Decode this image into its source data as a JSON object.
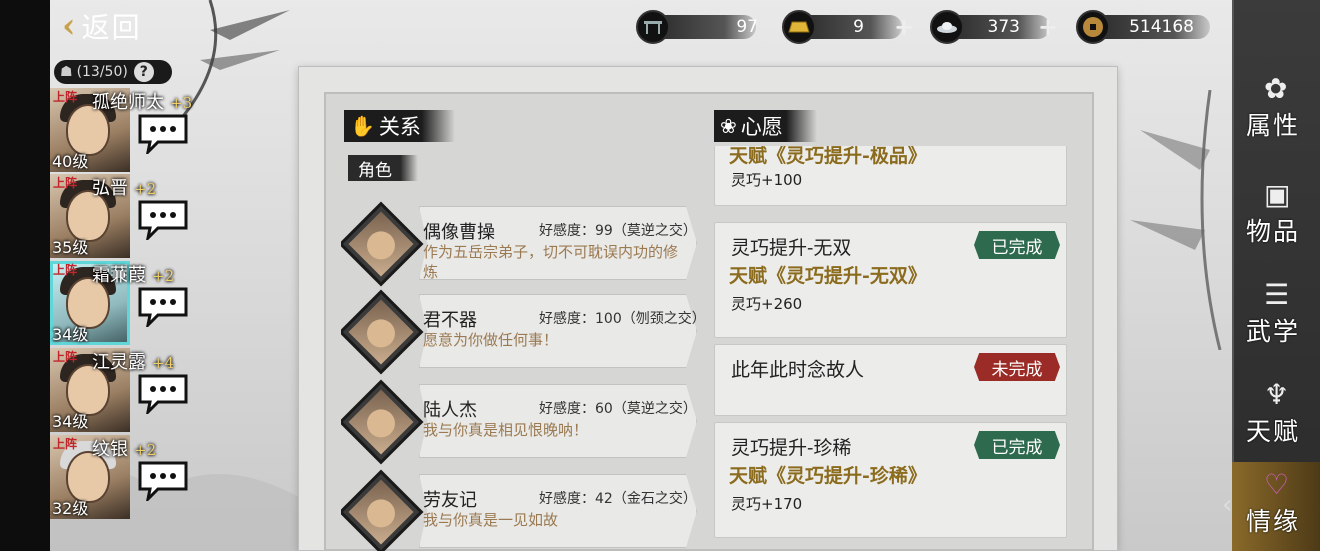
{
  "back": {
    "label": "返回"
  },
  "resources": [
    {
      "icon": "table-icon",
      "value": "97",
      "has_plus": false
    },
    {
      "icon": "gold-bar-icon",
      "value": "9",
      "has_plus": true
    },
    {
      "icon": "silver-ingot-icon",
      "value": "373",
      "has_plus": true
    },
    {
      "icon": "copper-coin-icon",
      "value": "514168",
      "has_plus": false
    }
  ],
  "roster": {
    "count": "(13/50)",
    "heroes": [
      {
        "onstage": "上阵",
        "name": "孤绝师太",
        "plus": "+3",
        "level": "40级",
        "selected": false
      },
      {
        "onstage": "上阵",
        "name": "弘晋",
        "plus": "+2",
        "level": "35级",
        "selected": false
      },
      {
        "onstage": "上阵",
        "name": "霜蒹葭",
        "plus": "+2",
        "level": "34级",
        "selected": true
      },
      {
        "onstage": "上阵",
        "name": "江灵露",
        "plus": "+4",
        "level": "34级",
        "selected": false
      },
      {
        "onstage": "上阵",
        "name": "纹银",
        "plus": "+2",
        "level": "32级",
        "selected": false
      }
    ]
  },
  "relations": {
    "tab_label": "关系",
    "role_tab": "角色",
    "items": [
      {
        "name": "偶像曹操",
        "fav": "好感度：99（莫逆之交）",
        "msg": "作为五岳宗弟子，切不可耽误内功的修炼"
      },
      {
        "name": "君不器",
        "fav": "好感度：100（刎颈之交）",
        "msg": "愿意为你做任何事！"
      },
      {
        "name": "陆人杰",
        "fav": "好感度：60（莫逆之交）",
        "msg": "我与你真是相见恨晚呐！"
      },
      {
        "name": "劳友记",
        "fav": "好感度：42（金石之交）",
        "msg": "我与你真是一见如故"
      }
    ]
  },
  "wishes": {
    "tab_label": "心愿",
    "items": [
      {
        "title": "",
        "reward": "天赋《灵巧提升-极品》",
        "attr": "灵巧+100",
        "status": ""
      },
      {
        "title": "灵巧提升-无双",
        "reward": "天赋《灵巧提升-无双》",
        "attr": "灵巧+260",
        "status": "已完成"
      },
      {
        "title": "此年此时念故人",
        "reward": "",
        "attr": "",
        "status": "未完成"
      },
      {
        "title": "灵巧提升-珍稀",
        "reward": "天赋《灵巧提升-珍稀》",
        "attr": "灵巧+170",
        "status": "已完成"
      }
    ]
  },
  "menu": {
    "items": [
      {
        "label": "属性",
        "icon": "attribute-icon",
        "active": false
      },
      {
        "label": "物品",
        "icon": "item-box-icon",
        "active": false
      },
      {
        "label": "武学",
        "icon": "martial-book-icon",
        "active": false
      },
      {
        "label": "天赋",
        "icon": "talent-icon",
        "active": false
      },
      {
        "label": "情缘",
        "icon": "heart-icon",
        "active": true
      }
    ]
  },
  "colors": {
    "accent_gold": "#c8a24a",
    "done_badge": "#2e6a4e",
    "todo_badge": "#9a2b26",
    "reward_text": "#8b6b1d"
  }
}
